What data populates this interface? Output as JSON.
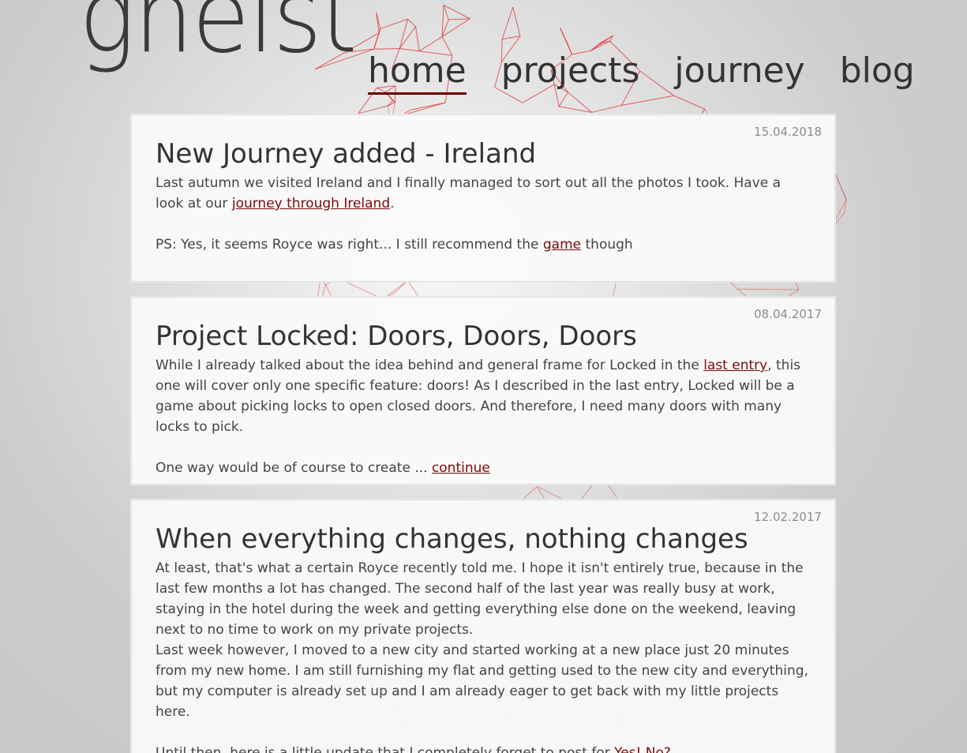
{
  "site": {
    "logo_text": "gheist"
  },
  "nav": {
    "home": "home",
    "projects": "projects",
    "journey": "journey",
    "blog": "blog",
    "active": "home",
    "accent_color": "#6b0000"
  },
  "posts": [
    {
      "date": "15.04.2018",
      "title": "New Journey added - Ireland",
      "p1_text_a": "Last autumn we visited Ireland and I finally managed to sort out all the photos I took. Have a look at our ",
      "p1_link": "journey through Ireland",
      "p1_text_b": ".",
      "p2_text_a": "PS: Yes, it seems Royce was right... I still recommend the ",
      "p2_link": "game",
      "p2_text_b": " though"
    },
    {
      "date": "08.04.2017",
      "title": "Project Locked: Doors, Doors, Doors",
      "p1_text_a": "While I already talked about the idea behind and general frame for Locked in the ",
      "p1_link": "last entry",
      "p1_text_b": ", this one will cover only one specific feature: doors! As I described in the last entry, Locked will be a game about picking locks to open closed doors. And therefore, I need many doors with many locks to pick.",
      "p2_text_a": "One way would be of course to create ... ",
      "p2_link": "continue"
    },
    {
      "date": "12.02.2017",
      "title": "When everything changes, nothing changes",
      "p1_text": "At least, that's what a certain Royce recently told me. I hope it isn't entirely true, because in the last few months a lot has changed. The second half of the last year was really busy at work, staying in the hotel during the week and getting everything else done on the weekend, leaving next to no time to work on my private projects.",
      "p2_text": "Last week however, I moved to a new city and started working at a new place just 20 minutes from my new home. I am still furnishing my flat and getting used to the new city and everything, but my computer is already set up and I am already eager to get back with my little projects here.",
      "p3_text_a": "Until then, here is a little update that I completely forget to post for ",
      "p3_link": "Yes! No?"
    }
  ],
  "colors": {
    "link": "#7a0a0a",
    "network_lines": "#e03030",
    "card_background": "#fafafa",
    "date_text": "#8c8c8c"
  }
}
